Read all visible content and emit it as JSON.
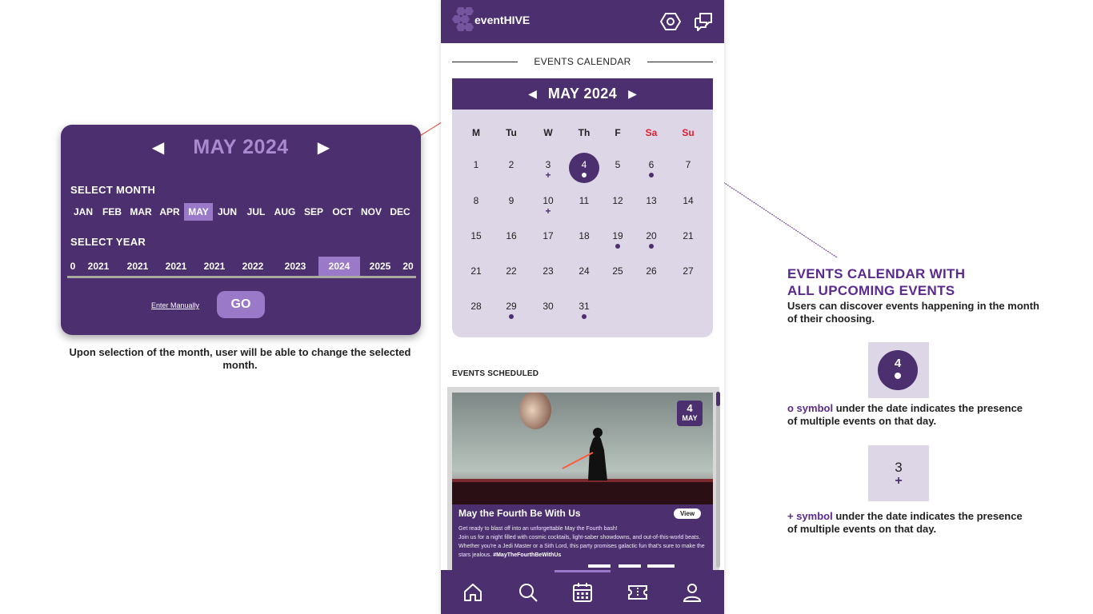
{
  "picker": {
    "title": "MAY 2024",
    "prev": "◀",
    "next": "▶",
    "select_month_label": "SELECT MONTH",
    "months": [
      "JAN",
      "FEB",
      "MAR",
      "APR",
      "MAY",
      "JUN",
      "JUL",
      "AUG",
      "SEP",
      "OCT",
      "NOV",
      "DEC"
    ],
    "selected_month": "MAY",
    "select_year_label": "SELECT YEAR",
    "years": [
      "0",
      "2021",
      "2021",
      "2021",
      "2021",
      "2022",
      "2023",
      "2024",
      "2025",
      "20"
    ],
    "selected_year": "2024",
    "enter_manually": "Enter Manually",
    "go": "GO"
  },
  "left_caption": "Upon selection of the month, user will be able to change the selected month.",
  "app": {
    "name": "eventHIVE",
    "events_calendar_title": "EVENTS CALENDAR",
    "calendar": {
      "title": "MAY 2024",
      "prev": "◀",
      "next": "▶",
      "weekdays": [
        "M",
        "Tu",
        "W",
        "Th",
        "F",
        "Sa",
        "Su"
      ],
      "weekend_color": "#e01e2e",
      "weeks": [
        [
          {
            "d": "1"
          },
          {
            "d": "2"
          },
          {
            "d": "3",
            "mark": "plus"
          },
          {
            "d": "4",
            "mark": "dot",
            "today": true
          },
          {
            "d": "5"
          },
          {
            "d": "6",
            "mark": "dot"
          },
          {
            "d": "7"
          }
        ],
        [
          {
            "d": "8"
          },
          {
            "d": "9"
          },
          {
            "d": "10",
            "mark": "plus"
          },
          {
            "d": "11"
          },
          {
            "d": "12"
          },
          {
            "d": "13"
          },
          {
            "d": "14"
          }
        ],
        [
          {
            "d": "15"
          },
          {
            "d": "16"
          },
          {
            "d": "17"
          },
          {
            "d": "18"
          },
          {
            "d": "19",
            "mark": "dot"
          },
          {
            "d": "20",
            "mark": "dot"
          },
          {
            "d": "21"
          }
        ],
        [
          {
            "d": "21"
          },
          {
            "d": "22"
          },
          {
            "d": "23"
          },
          {
            "d": "24"
          },
          {
            "d": "25"
          },
          {
            "d": "26"
          },
          {
            "d": "27"
          }
        ],
        [
          {
            "d": "28"
          },
          {
            "d": "29",
            "mark": "dot"
          },
          {
            "d": "30"
          },
          {
            "d": "31",
            "mark": "dot"
          }
        ]
      ]
    },
    "events_scheduled_title": "EVENTS SCHEDULED",
    "event": {
      "badge_day": "4",
      "badge_month": "MAY",
      "title": "May the Fourth Be With Us",
      "view": "View",
      "desc_1": "Get ready to blast off into an unforgettable May the Fourth bash!",
      "desc_2": "Join us for a night filled with cosmic cocktails, light-saber showdowns, and out-of-this-world beats. Whether you're a Jedi Master or a Sith Lord, this party promises galactic fun that's sure to make the stars jealous.",
      "hashtag": "#MayTheFourthBeWithUs"
    },
    "nav": [
      "home-icon",
      "search-icon",
      "calendar-icon",
      "ticket-icon",
      "profile-icon"
    ],
    "brand_color": "#4c2f6e",
    "accent_color": "#9b79c9"
  },
  "annotation": {
    "title_1": "EVENTS CALENDAR WITH",
    "title_2": "ALL UPCOMING EVENTS",
    "desc": "Users can discover events happening in the month of their choosing.",
    "sample_dot_num": "4",
    "sample_plus_num": "3",
    "sample_plus_glyph": "+",
    "dot_symbol": "o symbol",
    "dot_note": " under the date indicates the presence of multiple events on that day.",
    "plus_symbol": "+ symbol",
    "plus_note": " under the date indicates the presence of multiple events on that day."
  }
}
